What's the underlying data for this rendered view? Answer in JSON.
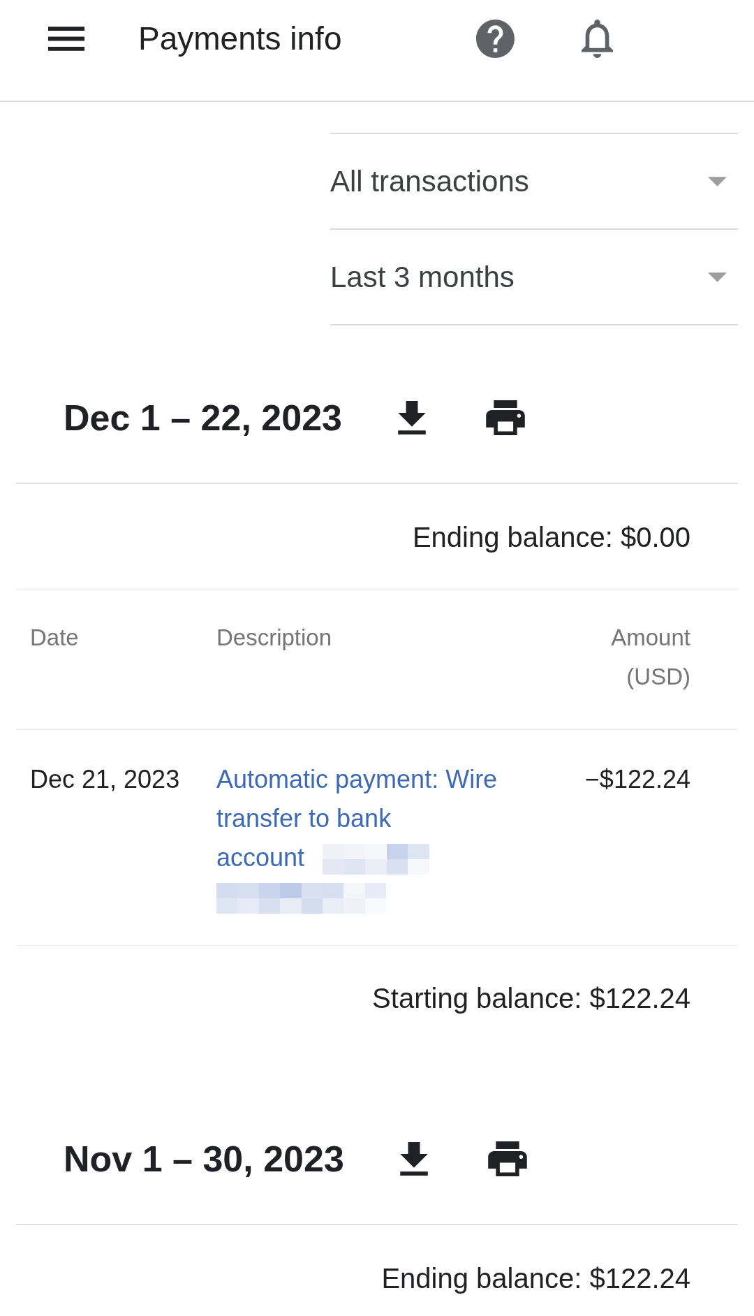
{
  "app_bar": {
    "title": "Payments info"
  },
  "filters": [
    {
      "value": "All transactions"
    },
    {
      "value": "Last 3 months"
    }
  ],
  "statements": [
    {
      "period": "Dec 1 – 22, 2023",
      "ending_balance": "Ending balance: $0.00",
      "columns": [
        "Date",
        "Description",
        "Amount (USD)"
      ],
      "transactions": [
        {
          "date": "Dec 21, 2023",
          "description": "Automatic payment: Wire transfer to bank account",
          "amount": "−$122.24",
          "redacted": true
        }
      ],
      "starting_balance": "Starting balance: $122.24"
    },
    {
      "period": "Nov 1 – 30, 2023",
      "ending_balance": "Ending balance: $122.24"
    }
  ]
}
